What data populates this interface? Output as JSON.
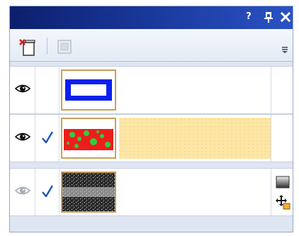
{
  "panel": {
    "title": "",
    "buttons": {
      "help_label": "?",
      "pin_label": "⬚",
      "close_label": "✕"
    }
  },
  "toolbar": {
    "new_layer_icon": "new-layer-icon",
    "disabled_icon": "mask-add-icon-disabled",
    "menu_label": "☰"
  },
  "layers": [
    {
      "visible": true,
      "linked": false,
      "selected": false,
      "thumbnail": "blue-rectangle-outline"
    },
    {
      "visible": true,
      "linked": true,
      "selected": true,
      "thumbnail": "red-green-texture"
    },
    {
      "visible": true,
      "linked": true,
      "selected": false,
      "thumbnail": "grayscale-noise",
      "dimmed_eye": true
    }
  ],
  "colors": {
    "title_bar_start": "#0c1f6d",
    "title_bar_end": "#2a52c4",
    "selection_fill": "#fde6a5",
    "thumbnail_border": "#caa05a",
    "check_color": "#1d57b8"
  }
}
